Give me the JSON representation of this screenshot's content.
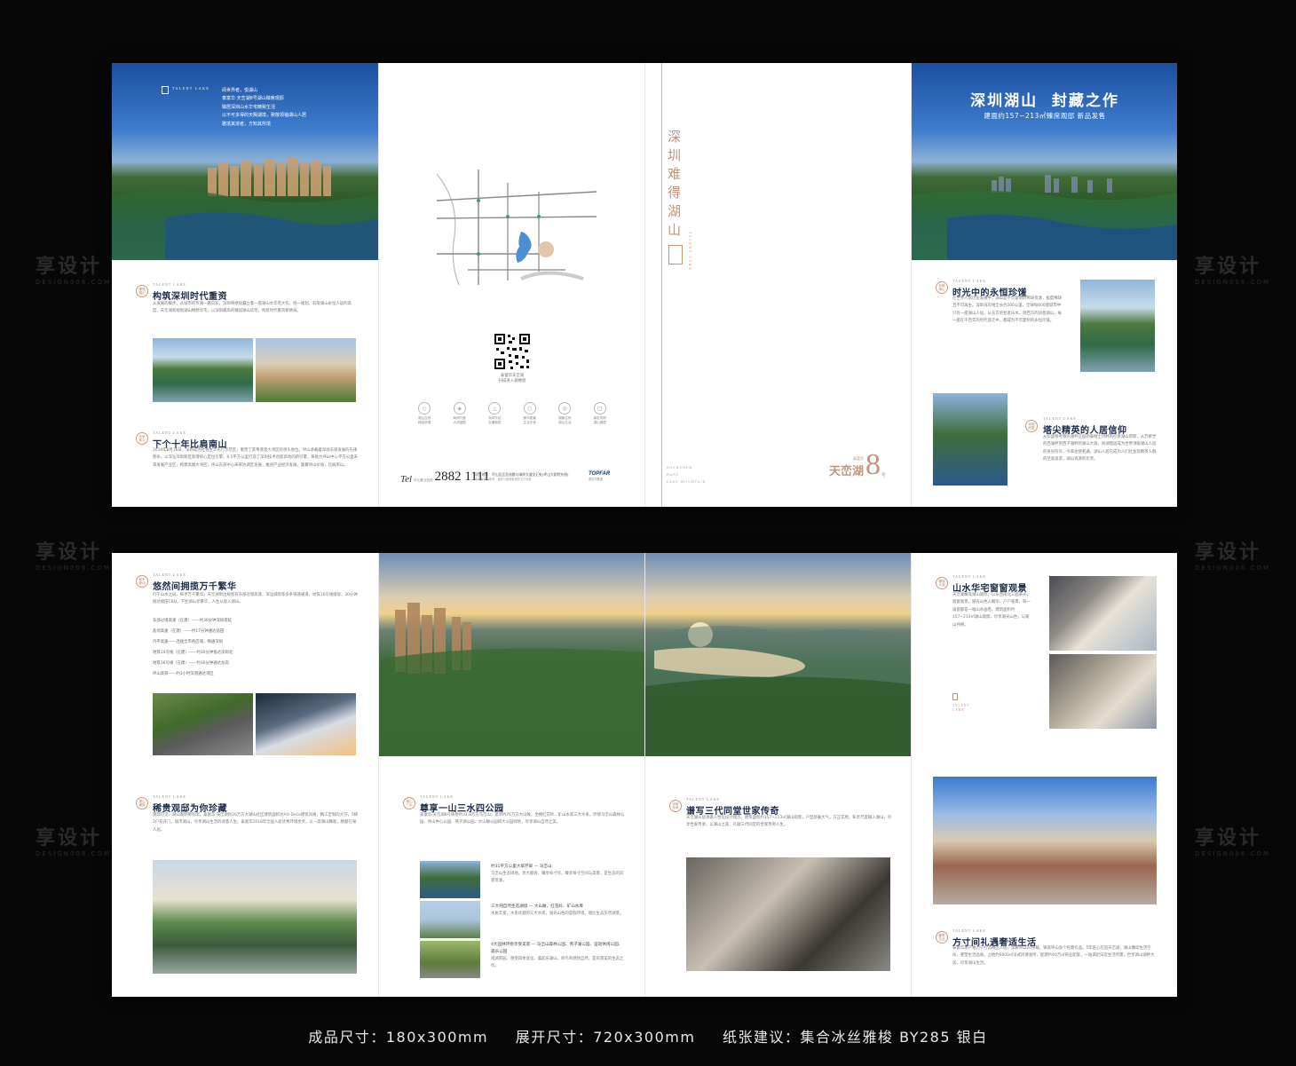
{
  "watermark": {
    "brand": "享设计",
    "url": "DESIGN006.COM"
  },
  "top": {
    "cover": {
      "logo_word": "TALENT LAKE",
      "lines": [
        "阅世界者，悦湖山",
        "泰富华·天峦湖8号湖山臻席观邸",
        "臻居深圳山水华宅精致生活",
        "以不可多得的天赐湖境，致敬领袖湖山人居",
        "雅境其境者，方知其所境"
      ]
    },
    "left": {
      "s1": {
        "brand": "TALENT LAKE",
        "seal": "臻席湖山",
        "title": "构筑深圳时代重资",
        "body": "从发展的脚步，从城市的罗湖一路向东，深圳将继续矗立着一座湖山水华宅大作。统一规划、有限湖山永恒人居的高度，天峦湖新规划湖山畅想华宅，以深圳最高的臻居湖山华宅，构筑时代重资新格局。"
      },
      "s2": {
        "brand": "TALENT LAKE",
        "seal": "未来核心",
        "title": "下个十年比肩南山",
        "body": "2019年8月18日，深圳成为社会主义先行示范区，重塑了其粤港澳大湾区的领头地位。坪山承载着深圳东部发展的先锋使命，以深汕深圳新区新增核心定位引擎，8.5平方公里打造了深圳技术创新高地的新引擎，将助力坪山中心平方公里未来发展产业区，构建高端大湾区，坪山东部中心未来协调区发展，推进产业经济发展，集聚坪山价值，比肩南山。"
      }
    },
    "map": {
      "qr_caption_1": "泰富华天峦湖",
      "qr_caption_2": "扫描进入微楼盘",
      "icons": [
        {
          "symbol": "◇",
          "label1": "湖山自然",
          "label2": "稀缺资源"
        },
        {
          "symbol": "◈",
          "label1": "两岸尺度",
          "label2": "大湾蓝图"
        },
        {
          "symbol": "△",
          "label1": "深圳东站",
          "label2": "交通枢纽"
        },
        {
          "symbol": "○",
          "label1": "都市配套",
          "label2": "生活无忧"
        },
        {
          "symbol": "◎",
          "label1": "湖景住所",
          "label2": "湖山生活"
        },
        {
          "symbol": "□",
          "label1": "豪宅府邸",
          "label2": "湖山臻居"
        }
      ],
      "phone_label": "Tel",
      "phone_prefix": "坪山置业热线",
      "phone": "2882 1111",
      "address": "项目地址：坪山区比亚迪路与绿梓大道交汇处(坪山大剧院东侧)",
      "disclaimer": "本资料仅作参考，最终以政府批准的文件为准",
      "developer": "TOPFAR",
      "developer_cn": "泰富华集团"
    },
    "spine": {
      "vertical_title": "深圳难得湖山",
      "logo_word": "TALENT LAKE",
      "en_lines": [
        "SHENZHEN",
        "RARE",
        "LAKE MOUNTAIN"
      ],
      "logo_cn": "天峦湖",
      "logo_prefix": "泰富华",
      "logo_number": "8",
      "logo_suffix": "号"
    },
    "right": {
      "headline": "深圳湖山  封藏之作",
      "subline": "建面约157~213㎡臻席观邸 新品发售",
      "s1": {
        "brand": "TALENT LAKE",
        "seal": "珍稀湖山",
        "title": "时光中的永恒珍馐",
        "body": "在世界人居历史发展中，湖山是不可复制的稀缺资源，极度稀缺且不可再生。深圳海岸线全长约260公里，全球每600座城市中只有一座湖山人居，从东方的智者乐水，到西方的诗意湖山，每一座在千百年的时代变迁中，都成为不可复制的永恒珍馐。"
      },
      "s2": {
        "brand": "TALENT LAKE",
        "seal": "尚湖而居",
        "title": "塔尖精英的人居信仰",
        "body": "从华盛顿考察的湖畔庄园到泰晤士河畔的伦敦湖山府邸，从苏黎世的西湖畔到西子湖畔的湖山大观，尚湖而居成为世界顶级湖山人居的身份符号，今来往使者通，湖山人居已成为人们社会及精英人群的至高追求，湖山资源的珍贵。"
      }
    }
  },
  "bottom": {
    "left": {
      "s1": {
        "brand": "TALENT LAKE",
        "seal": "城市脉动",
        "title": "悠然间拥揽万千繁华",
        "body": "行于山水之间，纵享万千繁华，天峦湖周边规划有东部过境高速、深汕城际等多条快速通道，地铁16号线接驳，30分钟抵达福田CBD，下坐湖山享繁华，人生从容入湖山。",
        "list": [
          "东部过境高速（在建）——约30分钟深圳南延",
          "盐坝高速（在建）——约17分钟通达盐田",
          "丹平高速——连接全市各区域，畅通深圳",
          "地铁14号线（在建）——约30分钟抵达深圳北",
          "地铁16号线（在建）——约30分钟通达龙岗",
          "坪山高铁——约1小时深港通达湾区"
        ]
      },
      "s2": {
        "brand": "TALENT LAKE",
        "seal": "湖山臻境",
        "title": "稀贵观邸为你珍藏",
        "body": "观邸可见，湖山观邸稀有席。泰富华·天峦湖约26万方大湖山社区建筑面积达Art-Deco建筑风格，精工定制的大方，5梯2户双开门，城市湖山，尽享湖山生活的诗意人生。泰富华2018年全国人居优秀环境金奖，以一席湖山臻观，致献在湖人居。"
      }
    },
    "center": {
      "brand": "TALENT LAKE",
      "seal": "湖山三水",
      "title": "尊享一山三水四公园",
      "body": "泰富华·天峦湖8号倚傍约31.8万方马峦山，紧邻约76万方大山陂，坐拥红花岭、矿山水库三大水系，环绕马峦山森林公园、坪山中心公园、燕子湖公园、大山陂公园四大公园绿地，尽享湖山自然之美。",
      "items": [
        {
          "title": "约31平方公里大翠芹屏 — 马峦山",
          "body": "马峦山生态绿地，享大都会，臻享每寸尽，臻享每寸空间与美景，是生态的风景资源。"
        },
        {
          "title": "三大纯自然生态湖境 — 大山陂、红花岭、矿山水库",
          "body": "水质丰富，水系优越的三大水库，湖光山色的度假环境，堪比生态天然湖景。"
        },
        {
          "title": "4大园林环绕享受美景 — 马峦山森林公园、燕子湖公园、运动休闲公园、森乐公园",
          "body": "观湖赏园、感受四季变化、晨起乐湖山，听鸟鸣感悟自然，是风景美的生态之作。"
        }
      ]
    },
    "center_right": {
      "brand": "TALENT LAKE",
      "seal": "世家传承",
      "title": "谱写三代同堂世家传奇",
      "body": "天峦湖山居承袭人性化设计理念，建筑面积约157~213㎡湖山观邸，户型舒展大气，方正实用，私享尺度融入湖山，尽享世家传承，以湖山之美，礼献三代同堂的世家传奇人生。"
    },
    "right": {
      "s1": {
        "brand": "TALENT LAKE",
        "seal": "臻境大观",
        "title": "山水华宅窗窗观景",
        "body": "天峦湖臻席湖山观邸，以东西南北三面采光，窗窗观景，湖光山色入眼帘。户户观景，每一扇窗都是一幅山水画卷。建筑面积约157~213㎡湖山观邸，尽享湖光山色，与湖山共栖。",
        "logo_word": "TALENT LAKE"
      },
      "s2": {
        "brand": "TALENT LAKE",
        "seal": "臻享生活",
        "title": "方寸间礼遇奢适生活",
        "body": "泰富华地产致力于打造精品人居，深耕坪山20余载，铸就坪山多个经典作品。5年匠心打造天峦湖，湖山臻席生活空间，重塑生活品质。占地约6000㎡法式风情会所，配建约40万㎡商业配套，一站满足日常生活所需，世享湖山湖畔大美，尽享湖山生活。"
      }
    }
  },
  "caption": {
    "size": "成品尺寸：180x300mm",
    "open": "展开尺寸：720x300mm",
    "paper": "纸张建议：集合冰丝雅梭  BY285 银白"
  }
}
